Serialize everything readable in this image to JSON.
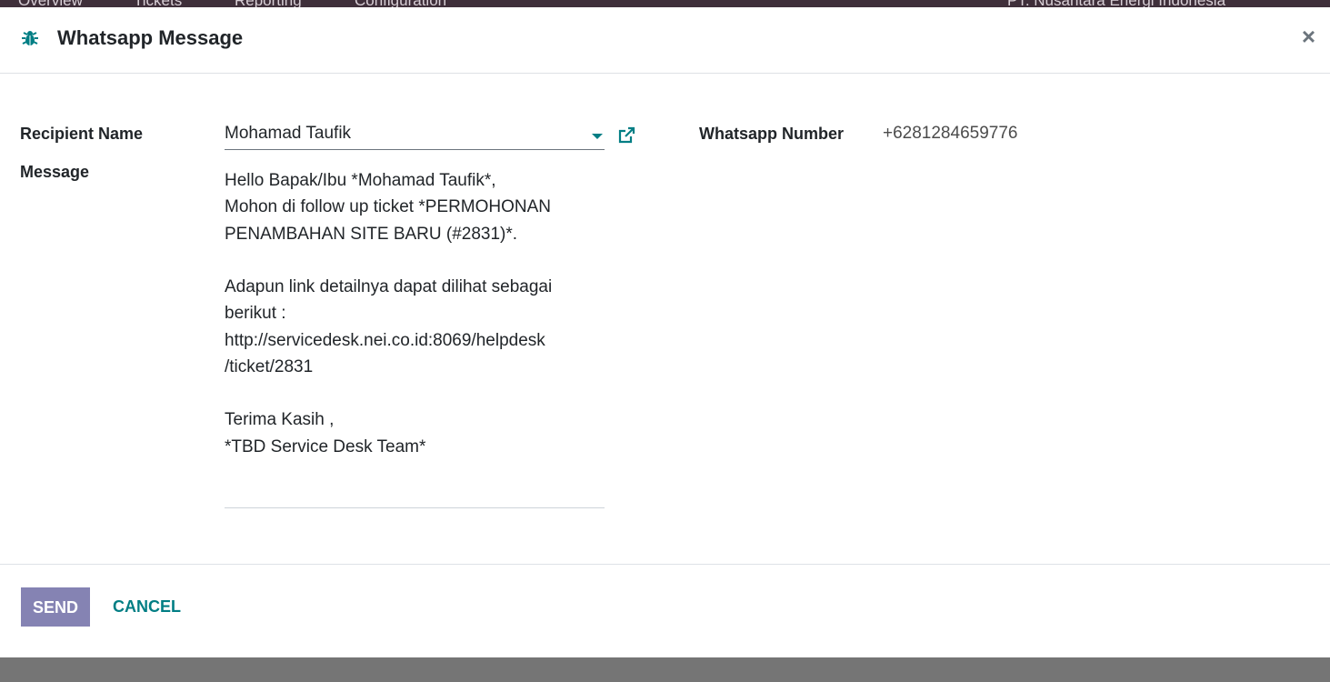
{
  "background_nav": {
    "items": [
      "Overview",
      "Tickets",
      "Reporting",
      "Configuration"
    ],
    "company": "PT. Nusantara Energi Indonesia"
  },
  "dialog": {
    "title": "Whatsapp Message",
    "close_label": "×",
    "icon": "bug-icon"
  },
  "form": {
    "recipient_label": "Recipient Name",
    "recipient_value": "Mohamad Taufik",
    "whatsapp_label": "Whatsapp Number",
    "whatsapp_value": "+6281284659776",
    "message_label": "Message",
    "message_lines": [
      "Hello Bapak/Ibu *Mohamad Taufik*,",
      "Mohon di follow up ticket *PERMOHONAN",
      "PENAMBAHAN SITE BARU (#2831)*.",
      "Adapun link detailnya dapat dilihat sebagai",
      "berikut :",
      "http://servicedesk.nei.co.id:8069/helpdesk",
      "/ticket/2831",
      "Terima Kasih ,",
      "*TBD Service Desk Team*"
    ]
  },
  "footer": {
    "send_label": "SEND",
    "cancel_label": "CANCEL"
  },
  "colors": {
    "accent": "#017e84",
    "send_button": "#8583b3",
    "topbar": "#3f2f3a"
  }
}
